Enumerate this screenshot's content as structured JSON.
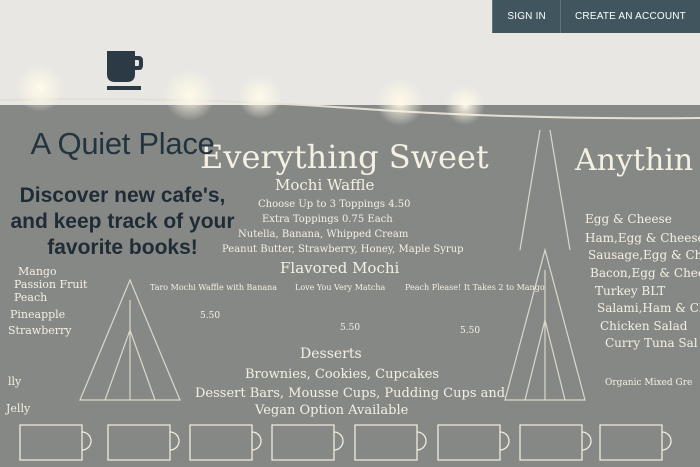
{
  "nav": {
    "sign_in": "SIGN IN",
    "create_account": "CREATE AN ACCOUNT"
  },
  "hero": {
    "logo_icon": "coffee-cup-icon",
    "title": "A Quiet Place",
    "subtitle": "Discover new cafe's, and keep track of your favorite books!"
  },
  "colors": {
    "nav_bg": "#41555f",
    "nav_text": "#ffffff",
    "title": "#24343f",
    "logo": "#2b3a44"
  }
}
